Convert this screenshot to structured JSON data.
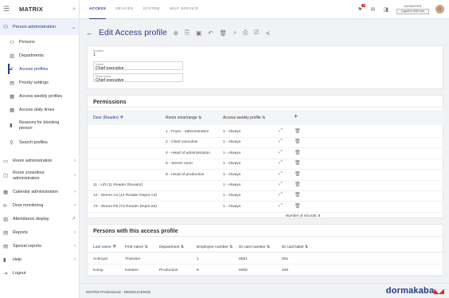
{
  "app": {
    "name": "MATRIX"
  },
  "sidebar": {
    "section": {
      "label": "Person administration"
    },
    "items": [
      {
        "label": "Persons",
        "icon": "person-icon"
      },
      {
        "label": "Departments",
        "icon": "building-icon"
      },
      {
        "label": "Access profiles",
        "icon": "lock-icon",
        "active": true
      },
      {
        "label": "Priority settings",
        "icon": "priority-icon"
      },
      {
        "label": "Access weekly profiles",
        "icon": "calendar-icon"
      },
      {
        "label": "Access daily times",
        "icon": "clock-icon"
      },
      {
        "label": "Reasons for blocking person",
        "icon": "block-icon"
      },
      {
        "label": "Search profiles",
        "icon": "search-icon"
      }
    ],
    "groups": [
      {
        "label": "Room administration"
      },
      {
        "label": "Room zone/door administration"
      },
      {
        "label": "Calendar administration"
      },
      {
        "label": "Door monitoring"
      },
      {
        "label": "Attendance display"
      },
      {
        "label": "Reports"
      },
      {
        "label": "Special reports"
      },
      {
        "label": "Help"
      },
      {
        "label": "Logout"
      }
    ]
  },
  "topbar": {
    "tabs": [
      "ACCESS",
      "DEVICES",
      "SYSTEM",
      "SELF SERVICE"
    ],
    "user_name": "MCMASTER",
    "logout_label": "Logoff in 600 min",
    "notifications_badge": "2"
  },
  "page": {
    "title": "Edit Access profile"
  },
  "form": {
    "number_label": "Number",
    "number_value": "1",
    "name_label": "Name",
    "name_value": "Chief executive",
    "short_name_label": "Short name",
    "short_name_value": "Chief executive"
  },
  "permissions": {
    "title": "Permissions",
    "columns": [
      "Door (Reader)",
      "Room zone/range",
      "Access weekly profile"
    ],
    "rows": [
      {
        "door": "",
        "zone": "1 - Foyer - administration",
        "profile": "1 - Always"
      },
      {
        "door": "",
        "zone": "2 - Chief executive",
        "profile": "1 - Always"
      },
      {
        "door": "",
        "zone": "4 - Head of administration",
        "profile": "1 - Always"
      },
      {
        "door": "",
        "zone": "6 - Server room",
        "profile": "1 - Always"
      },
      {
        "door": "",
        "zone": "8 - Head of production",
        "profile": "1 - Always"
      },
      {
        "door": "11 - Lift (11 Reader Elevator)",
        "zone": "",
        "profile": "1 - Always"
      },
      {
        "door": "12 - Stores A4 (12 Reader Depot A4)",
        "zone": "",
        "profile": "1 - Always"
      },
      {
        "door": "73 - Stores P8 (73 Reader Depot 83)",
        "zone": "",
        "profile": "1 - Always"
      }
    ],
    "record_count": "Number of records: 8"
  },
  "persons": {
    "title": "Persons with this access profile",
    "columns": [
      "Last name",
      "First name",
      "Department",
      "Employee number",
      "ID card number",
      "ID card label"
    ],
    "rows": [
      {
        "last": "Ackroyd",
        "first": "Thorsten",
        "dept": "",
        "emp": "1",
        "card": "9001",
        "label": "001"
      },
      {
        "last": "Kamp",
        "first": "Karsten",
        "dept": "Production",
        "emp": "9",
        "card": "9200",
        "label": "200"
      }
    ]
  },
  "footer": {
    "text": "MATRIX Professional - DEMOLICENCE",
    "brand": "dormakaba"
  }
}
